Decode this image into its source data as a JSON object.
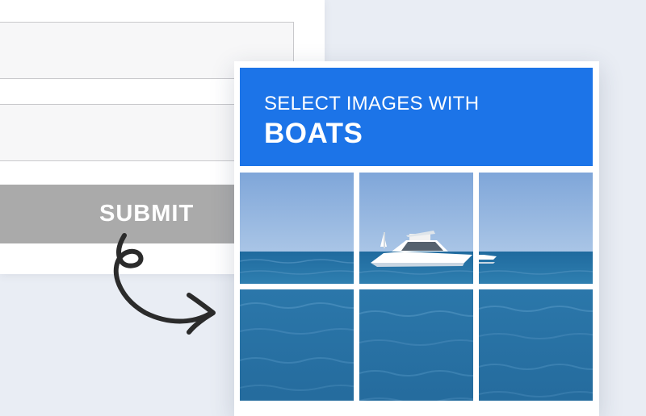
{
  "form": {
    "field_1_value": "",
    "field_2_value": "",
    "submit_label": "SUBMIT"
  },
  "captcha": {
    "prompt": "SELECT IMAGES WITH",
    "target": "BOATS",
    "tile_count": 9,
    "header_color": "#1c74e8"
  },
  "colors": {
    "background": "#e9edf4",
    "submit_button": "#aaaaaa",
    "sky": "#8fb2dd",
    "sea": "#2e77a8"
  },
  "icons": {
    "arrow": "curly-arrow-icon"
  }
}
